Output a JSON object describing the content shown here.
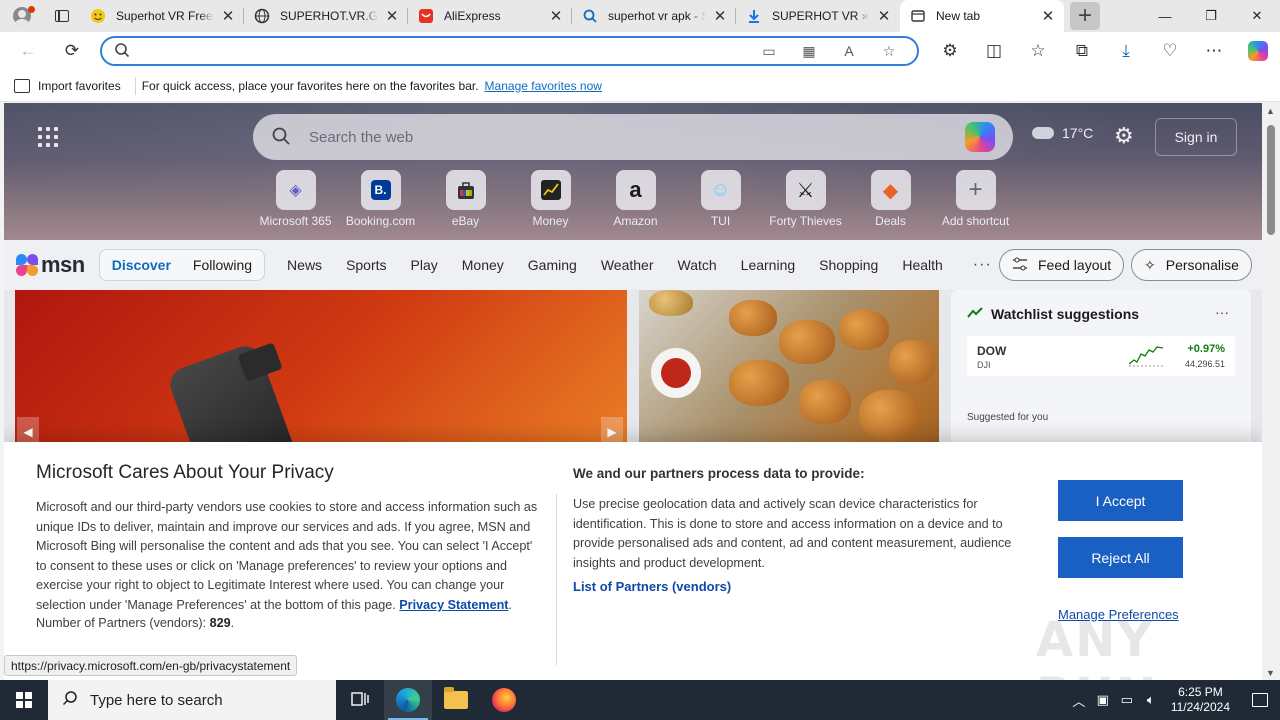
{
  "browser": {
    "tabs": [
      {
        "title": "Superhot VR Free D",
        "favicon": "emoji-face-icon",
        "color": "#f2c811",
        "active": false
      },
      {
        "title": "SUPERHOT.VR.Gam",
        "favicon": "globe-icon",
        "color": "#333333",
        "active": false
      },
      {
        "title": "AliExpress",
        "favicon": "aliexpress-icon",
        "color": "#e43225",
        "active": false
      },
      {
        "title": "superhot vr apk - S",
        "favicon": "search-icon",
        "color": "#0f6cbd",
        "active": false
      },
      {
        "title": "SUPERHOT VR » Cr",
        "favicon": "download-icon",
        "color": "#1a73e8",
        "active": false
      },
      {
        "title": "New tab",
        "favicon": "newtab-icon",
        "color": "#333333",
        "active": true
      }
    ],
    "address": {
      "value": "",
      "placeholder": ""
    },
    "favorites_bar": {
      "import_label": "Import favorites",
      "hint": "For quick access, place your favorites here on the favorites bar.",
      "manage_link": "Manage favorites now"
    },
    "status_url": "https://privacy.microsoft.com/en-gb/privacystatement"
  },
  "newtab": {
    "search_placeholder": "Search the web",
    "weather": "17°C",
    "signin_label": "Sign in",
    "shortcuts": [
      {
        "label": "Microsoft 365",
        "glyph": "◈",
        "color": "#5b5fc7"
      },
      {
        "label": "Booking.com",
        "glyph": "B.",
        "color": "#003b95"
      },
      {
        "label": "eBay",
        "glyph": "▣",
        "color": "#e53238"
      },
      {
        "label": "Money",
        "glyph": "▤",
        "color": "#222222"
      },
      {
        "label": "Amazon",
        "glyph": "a",
        "color": "#111111"
      },
      {
        "label": "TUI",
        "glyph": "☺",
        "color": "#70cbf4"
      },
      {
        "label": "Forty Thieves",
        "glyph": "✕",
        "color": "#222222"
      },
      {
        "label": "Deals",
        "glyph": "◆",
        "color": "#e8622c"
      },
      {
        "label": "Add shortcut",
        "glyph": "+",
        "color": "#666666"
      }
    ],
    "msn": {
      "logo_text": "msn",
      "tabs": [
        "Discover",
        "Following"
      ],
      "active_tab": "Discover",
      "nav": [
        "News",
        "Sports",
        "Play",
        "Money",
        "Gaming",
        "Weather",
        "Watch",
        "Learning",
        "Shopping",
        "Health"
      ],
      "more": "···",
      "feed_layout": "Feed layout",
      "personalise": "Personalise"
    },
    "watchlist": {
      "title": "Watchlist suggestions",
      "rows": [
        {
          "symbol": "DOW",
          "sub": "DJI",
          "change": "+0.97%",
          "value": "44,296.51"
        }
      ],
      "suggested_label": "Suggested for you"
    }
  },
  "consent": {
    "title": "Microsoft Cares About Your Privacy",
    "body": "Microsoft and our third-party vendors use cookies to store and access information such as unique IDs to deliver, maintain and improve our services and ads. If you agree, MSN and Microsoft Bing will personalise the content and ads that you see. You can select 'I Accept' to consent to these uses or click on 'Manage preferences' to review your options and exercise your right to object to Legitimate Interest where used.  You can change your selection under 'Manage Preferences' at the bottom of this page.",
    "privacy_link": "Privacy Statement",
    "partners_label": "Number of Partners (vendors): ",
    "partners_count": "829",
    "right_title": "We and our partners process data to provide:",
    "right_body": "Use precise geolocation data and actively scan device characteristics for identification. This is done to store and access information on a device and to provide personalised ads and content, ad and content measurement, audience insights and product development.",
    "vendors_link": "List of Partners (vendors)",
    "accept": "I Accept",
    "reject": "Reject All",
    "manage": "Manage Preferences"
  },
  "watermark": "ANY RUN",
  "taskbar": {
    "search_placeholder": "Type here to search",
    "time": "6:25 PM",
    "date": "11/24/2024"
  }
}
